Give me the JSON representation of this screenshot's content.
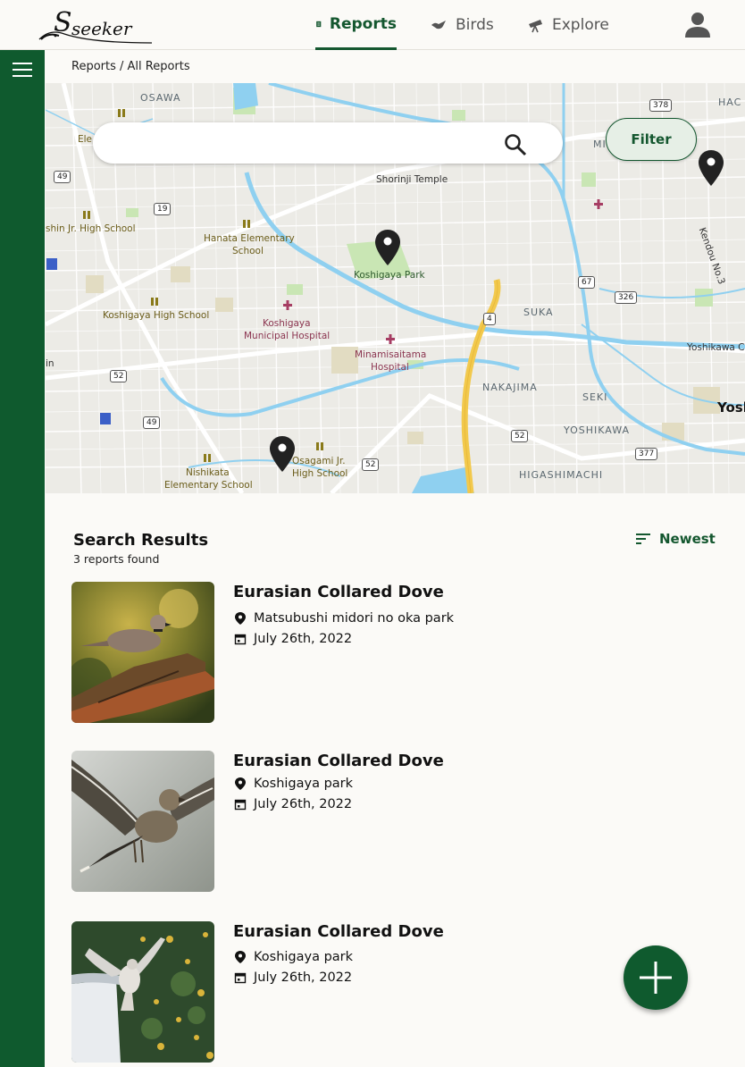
{
  "app": {
    "logo_text": "seeker",
    "logo_initial": "S"
  },
  "nav": {
    "items": [
      {
        "label": "Reports",
        "icon": "book-icon",
        "active": true
      },
      {
        "label": "Birds",
        "icon": "bird-icon",
        "active": false
      },
      {
        "label": "Explore",
        "icon": "telescope-icon",
        "active": false
      }
    ]
  },
  "breadcrumb": "Reports / All Reports",
  "search": {
    "placeholder": "",
    "value": ""
  },
  "filter": {
    "label": "Filter"
  },
  "map": {
    "labels": {
      "osawa": "OSAWA",
      "ele": "Ele",
      "shorinji": "Shorinji Temple",
      "shin_jr": "shin Jr. High School",
      "hanata": "Hanata Elementary",
      "hanata2": "School",
      "koshigaya_park": "Koshigaya Park",
      "koshigaya_high": "Koshigaya High School",
      "hospital1": "Koshigaya",
      "hospital1b": "Municipal Hospital",
      "minami": "Minamisaitama",
      "minami2": "Hospital",
      "suka": "SUKA",
      "nakajima": "NAKAJIMA",
      "seki": "SEKI",
      "yoshikawa": "YOSHIKAWA",
      "higashi": "HIGASHIMACHI",
      "nishikata": "Nishikata",
      "nishikata2": "Elementary School",
      "osagami": "Osagami Jr.",
      "osagami2": "High School",
      "yoshikawa_c": "Yoshikawa C",
      "yosh": "Yosh",
      "kendou": "Kendou No.3",
      "hac": "HAC",
      "mi": "MI",
      "in": "in"
    },
    "shields": [
      "378",
      "49",
      "19",
      "67",
      "326",
      "4",
      "52",
      "49",
      "52",
      "52",
      "377"
    ]
  },
  "results": {
    "title": "Search Results",
    "count": "3 reports found",
    "sort_label": "Newest",
    "items": [
      {
        "name": "Eurasian Collared Dove",
        "location": "Matsubushi midori no oka park",
        "date": "July 26th, 2022"
      },
      {
        "name": "Eurasian Collared Dove",
        "location": "Koshigaya park",
        "date": "July 26th, 2022"
      },
      {
        "name": "Eurasian Collared Dove",
        "location": "Koshigaya park",
        "date": "July 26th, 2022"
      }
    ]
  },
  "colors": {
    "brand": "#0f5a2e",
    "map_water": "#8fd0f0",
    "map_bg": "#ecebe6"
  }
}
